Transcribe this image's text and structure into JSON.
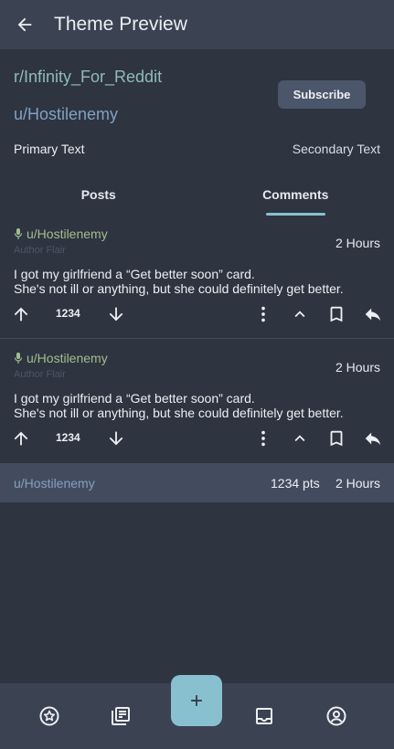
{
  "app_bar": {
    "title": "Theme Preview"
  },
  "header": {
    "subreddit": "r/Infinity_For_Reddit",
    "username": "u/Hostilenemy",
    "subscribe_label": "Subscribe",
    "primary_text": "Primary Text",
    "secondary_text": "Secondary Text"
  },
  "tabs": [
    {
      "label": "Posts",
      "active": false
    },
    {
      "label": "Comments",
      "active": true
    }
  ],
  "comments": [
    {
      "author": "u/Hostilenemy",
      "flair": "Author Flair",
      "time": "2 Hours",
      "body": "I got my girlfriend a “Get better soon” card.\nShe's not ill or anything, but she could definitely get better.",
      "score": "1234"
    },
    {
      "author": "u/Hostilenemy",
      "flair": "Author Flair",
      "time": "2 Hours",
      "body": "I got my girlfriend a “Get better soon” card.\nShe's not ill or anything, but she could definitely get better.",
      "score": "1234"
    }
  ],
  "collapsed_comment": {
    "author": "u/Hostilenemy",
    "points": "1234 pts",
    "time": "2 Hours"
  },
  "bottom_nav": {
    "items": [
      "star-icon",
      "library-icon",
      "add-icon",
      "inbox-icon",
      "account-icon"
    ]
  },
  "colors": {
    "background": "#2e3440",
    "bar": "#3b4252",
    "accent": "#88c0d0",
    "author": "#a3be8c",
    "username": "#81a1c1"
  }
}
